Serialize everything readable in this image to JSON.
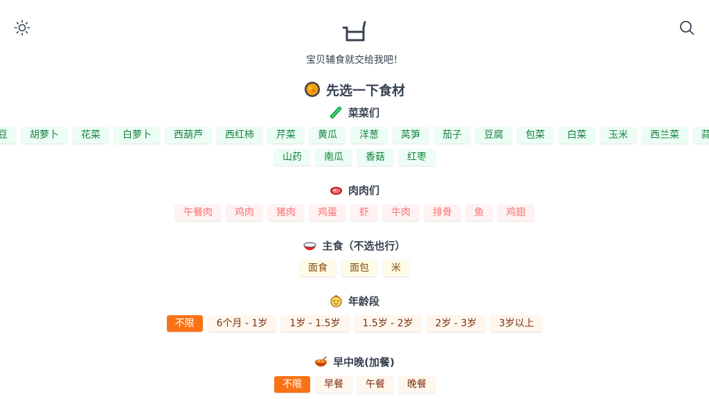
{
  "header": {
    "subtitle": "宝贝辅食就交给我吧！",
    "icons": [
      "sun-icon",
      "pot-icon",
      "search-icon"
    ]
  },
  "main_title": "先选一下食材",
  "vegetables": {
    "title": "菜菜们",
    "items": [
      "土豆",
      "胡萝卜",
      "花菜",
      "白萝卜",
      "西葫芦",
      "西红柿",
      "芹菜",
      "黄瓜",
      "洋葱",
      "莴笋",
      "茄子",
      "豆腐",
      "包菜",
      "白菜",
      "玉米",
      "西兰菜",
      "蒜苗",
      "山药",
      "南瓜",
      "香菇",
      "红枣"
    ]
  },
  "meats": {
    "title": "肉肉们",
    "items": [
      "午餐肉",
      "鸡肉",
      "猪肉",
      "鸡蛋",
      "虾",
      "牛肉",
      "排骨",
      "鱼",
      "鸡翅"
    ]
  },
  "staples": {
    "title": "主食（不选也行）",
    "items": [
      "面食",
      "面包",
      "米"
    ]
  },
  "age": {
    "title": "年龄段",
    "items": [
      "不限",
      "6个月 - 1岁",
      "1岁 - 1.5岁",
      "1.5岁 - 2岁",
      "2岁 - 3岁",
      "3岁以上"
    ],
    "selected": "不限"
  },
  "meal": {
    "title": "早中晚(加餐)",
    "items": [
      "不限",
      "早餐",
      "午餐",
      "晚餐"
    ],
    "selected": "不限"
  },
  "colors": {
    "accent": "#f97316",
    "veg_bg": "#ecfdf5",
    "veg_text": "#15803d",
    "meat_bg": "#fef2f2",
    "meat_text": "#f87171",
    "staple_bg": "#fefce8",
    "option_bg": "#fff7ed"
  }
}
